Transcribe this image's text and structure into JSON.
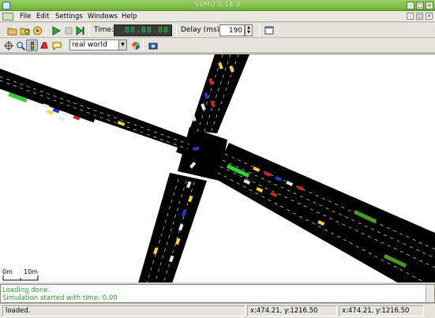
{
  "window": {
    "title": "SUMO 0.18.0",
    "buttons": [
      "-",
      "□",
      "×"
    ]
  },
  "menu": {
    "items": [
      "File",
      "Edit",
      "Settings",
      "Windows",
      "Help"
    ],
    "mdi_buttons": [
      "-",
      "□",
      "×"
    ]
  },
  "toolbar1": {
    "buttons": [
      "open-icon",
      "reload-icon",
      "recent-icon",
      "run-icon",
      "stop-icon",
      "step-icon",
      "window-icon"
    ],
    "time_label": "Time:",
    "time_value": "88.88.88",
    "delay_label": "Delay (ms):",
    "delay_value": "190"
  },
  "toolbar2": {
    "buttons": [
      "recenter-icon",
      "zoom-icon",
      "locate-icon",
      "locate-vehicle-icon",
      "tooltip-icon",
      "screenshot-icon"
    ],
    "scheme_value": "real world"
  },
  "view": {
    "scale_labels": [
      "0m",
      "10m"
    ]
  },
  "messages": [
    "Loading done.",
    "Simulation started with time: 0.00"
  ],
  "status": {
    "left": "loaded.",
    "coord1": "x:474.21, y:1216.50",
    "coord2": "x:474.21, y:1216.50"
  },
  "colors": {
    "road": "#000000",
    "lane_marking": "#ffffff",
    "message_green": "#2a9a2a",
    "titlebar": "#6fae3a"
  }
}
